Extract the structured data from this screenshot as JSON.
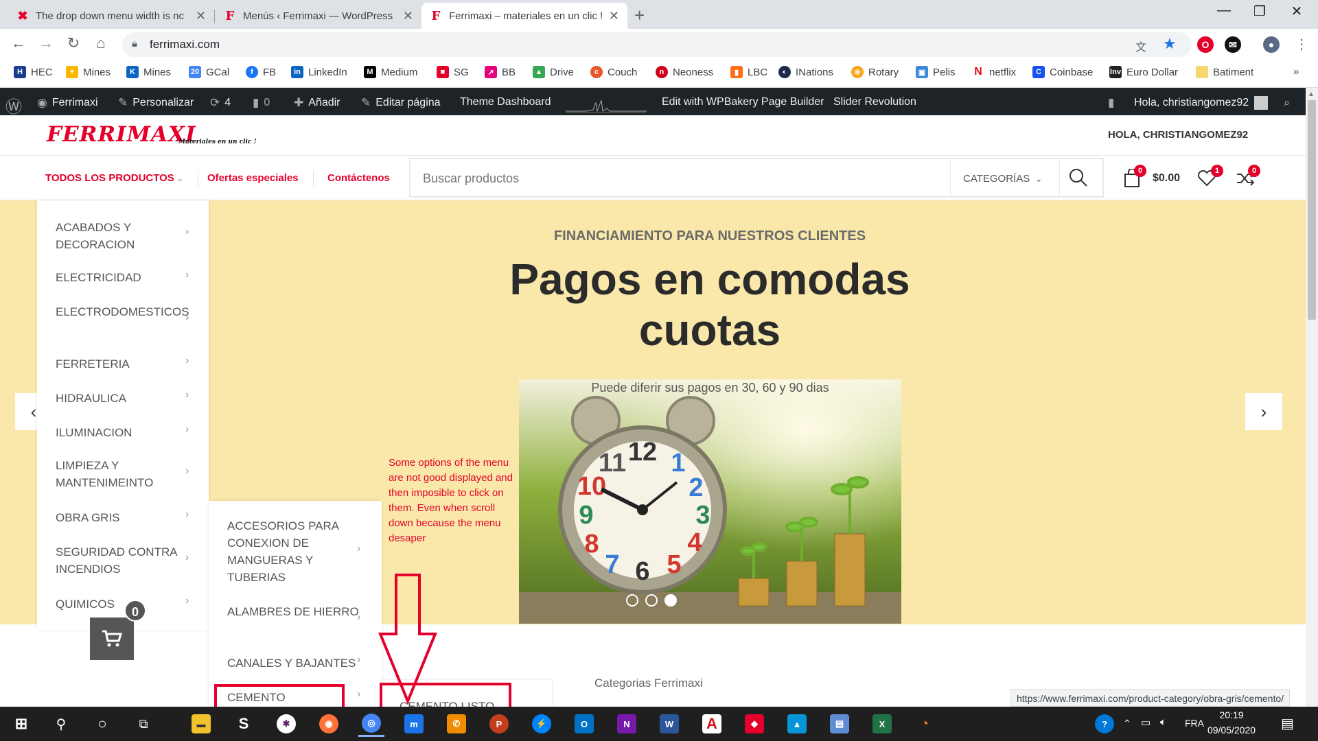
{
  "browser": {
    "tabs": [
      {
        "title": "The drop down menu width is nc",
        "close": "✕"
      },
      {
        "title": "Menús ‹ Ferrimaxi — WordPress",
        "close": "✕"
      },
      {
        "title": "Ferrimaxi – materiales en un clic !",
        "close": "✕"
      }
    ],
    "new_tab": "+",
    "url": "ferrimaxi.com",
    "bookmarks": [
      "HEC",
      "Mines",
      "Mines",
      "GCal",
      "FB",
      "LinkedIn",
      "Medium",
      "SG",
      "BB",
      "Drive",
      "Couch",
      "Neoness",
      "LBC",
      "INations",
      "Rotary",
      "Pelis",
      "netflix",
      "Coinbase",
      "Euro Dollar",
      "Batiment"
    ],
    "bookmarks_more": "»",
    "status_url": "https://www.ferrimaxi.com/product-category/obra-gris/cemento/"
  },
  "wp_admin_bar": {
    "site": "Ferrimaxi",
    "customize": "Personalizar",
    "updates": "4",
    "comments": "0",
    "add_new": "Añadir",
    "edit_page": "Editar página",
    "theme_dashboard": "Theme Dashboard",
    "wpbakery": "Edit with WPBakery Page Builder",
    "slider": "Slider Revolution",
    "greeting": "Hola, christiangomez92"
  },
  "header": {
    "logo": "FERRIMAXI",
    "tagline": "Materiales en un clic !",
    "greeting": "HOLA, CHRISTIANGOMEZ92",
    "nav": [
      "TODOS LOS PRODUCTOS",
      "Ofertas especiales",
      "Contáctenos"
    ],
    "search_placeholder": "Buscar productos",
    "categories_label": "CATEGORÍAS",
    "cart_count": "0",
    "cart_total": "$0.00",
    "wishlist_count": "1",
    "compare_count": "0"
  },
  "menu_level1": [
    "ACABADOS Y DECORACION",
    "ELECTRICIDAD",
    "ELECTRODOMESTICOS",
    "FERRETERIA",
    "HIDRAULICA",
    "ILUMINACION",
    "LIMPIEZA Y MANTENIMEINTO",
    "OBRA GRIS",
    "SEGURIDAD CONTRA INCENDIOS",
    "QUIMICOS"
  ],
  "menu_level2": [
    "ACCESORIOS PARA CONEXION DE MANGUERAS Y TUBERIAS",
    "ALAMBRES DE HIERRO",
    "CANALES Y BAJANTES",
    "CEMENTO"
  ],
  "menu_level3": [
    "CEMENTO LISTO"
  ],
  "hero": {
    "subtitle": "FINANCIAMIENTO PARA NUESTROS CLIENTES",
    "title": "Pagos en comodas cuotas",
    "caption": "Puede diferir sus pagos en 30, 60 y 90 dias",
    "slides": 3,
    "active_slide": 3
  },
  "annotation": "Some options of the menu are not good displayed and then imposible to click on them. Even when scroll down because the menu desaper",
  "section_title": "Categorias Ferrimaxi",
  "floating_cart_count": "0",
  "taskbar": {
    "lang": "FRA",
    "time": "20:19",
    "date": "09/05/2020"
  },
  "colors": {
    "brand_red": "#e4002b",
    "hero_bg": "#f9e8a9",
    "wp_bar": "#1d2327",
    "taskbar": "#1f1f1f"
  }
}
